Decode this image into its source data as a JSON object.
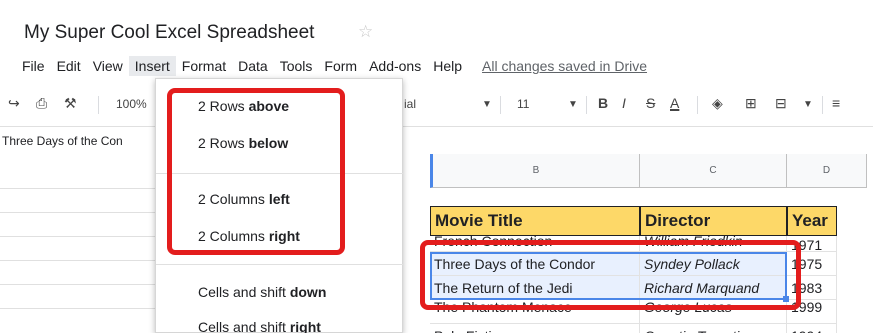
{
  "title": "My Super Cool Excel Spreadsheet",
  "menubar": {
    "items": [
      "File",
      "Edit",
      "View",
      "Insert",
      "Format",
      "Data",
      "Tools",
      "Form",
      "Add-ons",
      "Help"
    ],
    "saved": "All changes saved in Drive"
  },
  "toolbar": {
    "zoom": "100%",
    "font_partial": "ial",
    "font_size": "11"
  },
  "formula": {
    "cell_text": "Three Days of the Con"
  },
  "columns": [
    "B",
    "C",
    "D"
  ],
  "insert_menu": {
    "rows_above": {
      "pre": "2 Rows ",
      "bold": "above"
    },
    "rows_below": {
      "pre": "2 Rows ",
      "bold": "below"
    },
    "cols_left": {
      "pre": "2 Columns ",
      "bold": "left"
    },
    "cols_right": {
      "pre": "2 Columns ",
      "bold": "right"
    },
    "shift_down": {
      "pre": "Cells and shift ",
      "bold": "down"
    },
    "shift_right": {
      "pre": "Cells and shift ",
      "bold": "right"
    }
  },
  "sheet": {
    "headers": [
      "Movie Title",
      "Director",
      "Year"
    ],
    "rows": [
      [
        "French Connection",
        "William Friedkin",
        "1971"
      ],
      [
        "Three Days of the Condor",
        "Syndey Pollack",
        "1975"
      ],
      [
        "The Return of the Jedi",
        "Richard Marquand",
        "1983"
      ],
      [
        "The Phantom Menace",
        "George Lucas",
        "1999"
      ],
      [
        "Pulp Fiction",
        "Quentin Tarantino",
        "1994"
      ]
    ]
  },
  "colors": {
    "accent": "#4a86e8",
    "highlight": "#e31d1d",
    "header_fill": "#fdd868"
  }
}
